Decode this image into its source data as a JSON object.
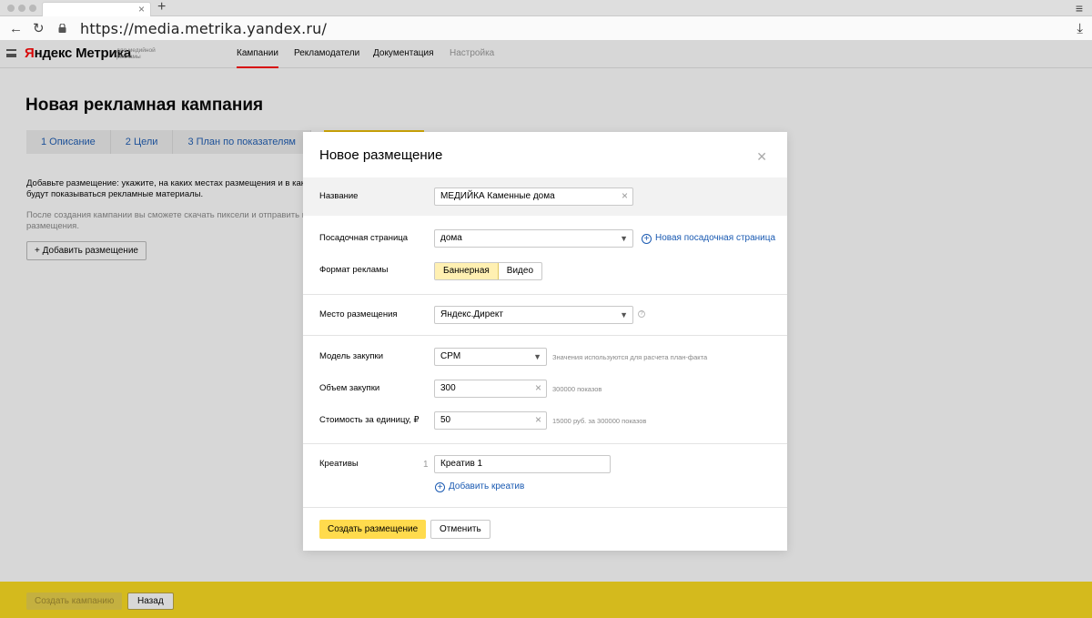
{
  "browser": {
    "url": "https://media.metrika.yandex.ru/",
    "icons": [
      "back-icon",
      "reload-icon",
      "lock-icon",
      "download-icon",
      "menu-icon"
    ]
  },
  "header": {
    "logo_brand_y": "Я",
    "logo_brand_rest": "ндекс",
    "logo_product": " Метрика",
    "logo_sub": "для медийной рекламы",
    "nav": [
      {
        "label": "Кампании",
        "active": true
      },
      {
        "label": "Рекламодатели"
      },
      {
        "label": "Документация"
      },
      {
        "label": "Настройка",
        "muted": true
      }
    ]
  },
  "main": {
    "title": "Новая рекламная кампания",
    "steps": [
      "1  Описание",
      "2  Цели",
      "3  План по показателям"
    ],
    "intro": "Добавьте размещение: укажите, на каких местах размещения и в как будут показываться рекламные материалы.",
    "intro_muted": "После создания кампании вы сможете скачать пиксели и отправить и размещения.",
    "add_place_label": "+ Добавить размещение"
  },
  "footer": {
    "create_campaign_label": "Создать кампанию",
    "back_label": "Назад"
  },
  "modal": {
    "title": "Новое размещение",
    "name_label": "Название",
    "name_value": "МЕДИЙКА Каменные дома",
    "landing_label": "Посадочная страница",
    "landing_value": "дома",
    "new_landing_link": "Новая посадочная страница",
    "format_label": "Формат рекламы",
    "format_options": [
      "Баннерная",
      "Видео"
    ],
    "format_selected": "Баннерная",
    "place_label": "Место размещения",
    "place_value": "Яндекс.Директ",
    "model_label": "Модель закупки",
    "model_value": "CPM",
    "model_hint": "Значения используются для расчета план-факта",
    "volume_label": "Объем закупки",
    "volume_value": "300",
    "volume_hint": "300000 показов",
    "cost_label": "Стоимость за единицу, ₽",
    "cost_value": "50",
    "cost_hint": "15000 руб. за 300000 показов",
    "creatives_label": "Креативы",
    "creative_index": "1",
    "creative_value": "Креатив 1",
    "add_creative_link": "Добавить креатив",
    "create_button": "Создать размещение",
    "cancel_button": "Отменить"
  }
}
